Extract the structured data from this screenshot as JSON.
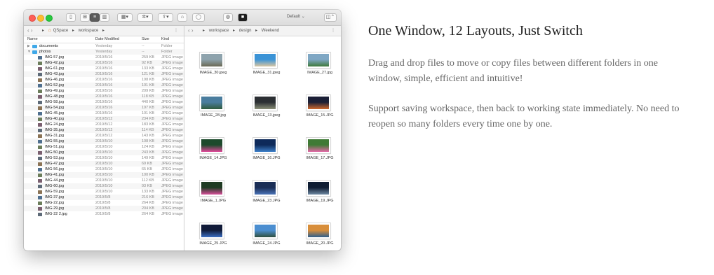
{
  "window": {
    "toolbar": {
      "layout_label": "Default"
    },
    "left_pane": {
      "breadcrumbs": [
        "QSpace",
        "workspace"
      ],
      "columns": {
        "name": "Name",
        "date": "Date Modified",
        "size": "Size",
        "kind": "Kind"
      },
      "rows": [
        {
          "name": "documents",
          "date": "Yesterday",
          "size": "--",
          "kind": "Folder",
          "type": "folder"
        },
        {
          "name": "photos",
          "date": "Yesterday",
          "size": "--",
          "kind": "Folder",
          "type": "folder"
        },
        {
          "name": "IMG-57.jpg",
          "date": "2019/5/16",
          "size": "259 KB",
          "kind": "JPEG image",
          "type": "file"
        },
        {
          "name": "IMG-42.jpg",
          "date": "2019/5/16",
          "size": "92 KB",
          "kind": "JPEG image",
          "type": "file"
        },
        {
          "name": "IMG-61.jpg",
          "date": "2019/5/16",
          "size": "133 KB",
          "kind": "JPEG image",
          "type": "file"
        },
        {
          "name": "IMG-43.jpg",
          "date": "2019/5/16",
          "size": "121 KB",
          "kind": "JPEG image",
          "type": "file"
        },
        {
          "name": "IMG-46.jpg",
          "date": "2019/5/16",
          "size": "198 KB",
          "kind": "JPEG image",
          "type": "file"
        },
        {
          "name": "IMG-52.jpg",
          "date": "2019/5/16",
          "size": "101 KB",
          "kind": "JPEG image",
          "type": "file"
        },
        {
          "name": "IMG-49.jpg",
          "date": "2019/5/16",
          "size": "209 KB",
          "kind": "JPEG image",
          "type": "file"
        },
        {
          "name": "IMG-48.jpg",
          "date": "2019/5/16",
          "size": "118 KB",
          "kind": "JPEG image",
          "type": "file"
        },
        {
          "name": "IMG-58.jpg",
          "date": "2019/5/16",
          "size": "440 KB",
          "kind": "JPEG image",
          "type": "file"
        },
        {
          "name": "IMG-54.jpg",
          "date": "2019/5/16",
          "size": "197 KB",
          "kind": "JPEG image",
          "type": "file"
        },
        {
          "name": "IMG-45.jpg",
          "date": "2019/5/16",
          "size": "101 KB",
          "kind": "JPEG image",
          "type": "file"
        },
        {
          "name": "IMG-40.jpg",
          "date": "2019/5/12",
          "size": "234 KB",
          "kind": "JPEG image",
          "type": "file"
        },
        {
          "name": "IMG-24.jpg",
          "date": "2019/5/12",
          "size": "183 KB",
          "kind": "JPEG image",
          "type": "file"
        },
        {
          "name": "IMG-35.jpg",
          "date": "2019/5/12",
          "size": "114 KB",
          "kind": "JPEG image",
          "type": "file"
        },
        {
          "name": "IMG-31.jpg",
          "date": "2019/5/12",
          "size": "143 KB",
          "kind": "JPEG image",
          "type": "file"
        },
        {
          "name": "IMG-55.jpg",
          "date": "2019/5/10",
          "size": "108 KB",
          "kind": "JPEG image",
          "type": "file"
        },
        {
          "name": "IMG-51.jpg",
          "date": "2019/5/10",
          "size": "124 KB",
          "kind": "JPEG image",
          "type": "file"
        },
        {
          "name": "IMG-50.jpg",
          "date": "2019/5/10",
          "size": "243 KB",
          "kind": "JPEG image",
          "type": "file"
        },
        {
          "name": "IMG-53.jpg",
          "date": "2019/5/10",
          "size": "149 KB",
          "kind": "JPEG image",
          "type": "file"
        },
        {
          "name": "IMG-47.jpg",
          "date": "2019/5/10",
          "size": "69 KB",
          "kind": "JPEG image",
          "type": "file"
        },
        {
          "name": "IMG-56.jpg",
          "date": "2019/5/10",
          "size": "65 KB",
          "kind": "JPEG image",
          "type": "file"
        },
        {
          "name": "IMG-41.jpg",
          "date": "2019/5/10",
          "size": "100 KB",
          "kind": "JPEG image",
          "type": "file"
        },
        {
          "name": "IMG-44.jpg",
          "date": "2019/5/10",
          "size": "112 KB",
          "kind": "JPEG image",
          "type": "file"
        },
        {
          "name": "IMG-60.jpg",
          "date": "2019/5/10",
          "size": "93 KB",
          "kind": "JPEG image",
          "type": "file"
        },
        {
          "name": "IMG-59.jpg",
          "date": "2019/5/10",
          "size": "133 KB",
          "kind": "JPEG image",
          "type": "file"
        },
        {
          "name": "IMG-37.jpg",
          "date": "2019/5/8",
          "size": "216 KB",
          "kind": "JPEG image",
          "type": "file"
        },
        {
          "name": "IMG-22.jpg",
          "date": "2019/5/8",
          "size": "264 KB",
          "kind": "JPEG image",
          "type": "file"
        },
        {
          "name": "IMG-29.jpg",
          "date": "2019/5/8",
          "size": "204 KB",
          "kind": "JPEG image",
          "type": "file"
        },
        {
          "name": "IMG-22 2.jpg",
          "date": "2019/5/8",
          "size": "264 KB",
          "kind": "JPEG image",
          "type": "file"
        }
      ]
    },
    "right_pane": {
      "breadcrumbs": [
        "workspace",
        "design",
        "Weekend"
      ],
      "thumbnails": [
        {
          "label": "IMAGE_30.jpeg",
          "colors": [
            "#8ea3ad",
            "#6b6a55"
          ]
        },
        {
          "label": "IMAGE_31.jpeg",
          "colors": [
            "#3b93d6",
            "#d9c6a2"
          ]
        },
        {
          "label": "IMAGE_27.jpg",
          "colors": [
            "#7fa7c4",
            "#3e7a3a"
          ]
        },
        {
          "label": "IMAGE_28.jpg",
          "colors": [
            "#4a7d9e",
            "#2f5a3c"
          ]
        },
        {
          "label": "IMAGE_13.jpeg",
          "colors": [
            "#2b2f33",
            "#8a8f78"
          ]
        },
        {
          "label": "IMAGE_15.JPG",
          "colors": [
            "#1b1f36",
            "#d06a2f"
          ]
        },
        {
          "label": "IMAGE_14.JPG",
          "colors": [
            "#1d4a2c",
            "#e04a9a"
          ]
        },
        {
          "label": "IMAGE_16.JPG",
          "colors": [
            "#0e2a5a",
            "#3d7fc9"
          ]
        },
        {
          "label": "IMAGE_17.JPG",
          "colors": [
            "#3f7a35",
            "#e36aa8"
          ]
        },
        {
          "label": "IMAGE_1.JPG",
          "colors": [
            "#1f3b23",
            "#d84e9a"
          ]
        },
        {
          "label": "IMAGE_23.JPG",
          "colors": [
            "#1a2e56",
            "#4a74b8"
          ]
        },
        {
          "label": "IMAGE_19.JPG",
          "colors": [
            "#0f1d33",
            "#6f8aa3"
          ]
        },
        {
          "label": "IMAGE_25.JPG",
          "colors": [
            "#101a38",
            "#3b6ec2"
          ]
        },
        {
          "label": "IMAGE_24.JPG",
          "colors": [
            "#4b8ed0",
            "#2f4f3e"
          ]
        },
        {
          "label": "IMAGE_20.JPG",
          "colors": [
            "#d88e3a",
            "#2d5e8e"
          ]
        }
      ]
    }
  },
  "headline": "One Window, 12 Layouts, Just Switch",
  "paragraphs": [
    "Drag and drop files to move or copy files between different folders in one window, simple, efficient and intuitive!",
    "Support saving workspace, then back to working state immediately. No need to reopen so many folders every time one by one."
  ]
}
